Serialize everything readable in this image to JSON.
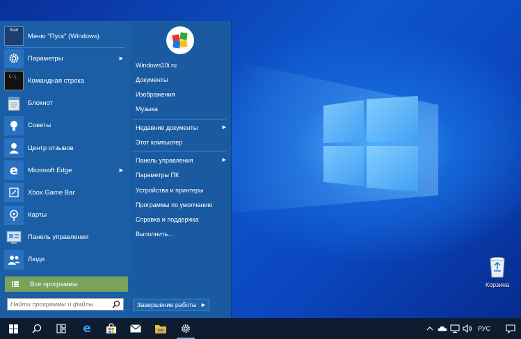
{
  "desktop": {
    "recycle_bin_label": "Корзина"
  },
  "start_menu": {
    "programs": [
      {
        "label": "Меню \"Пуск\" (Windows)",
        "icon": "start-menu-icon",
        "has_submenu": false
      },
      {
        "label": "Параметры",
        "icon": "gear-icon",
        "has_submenu": true
      },
      {
        "label": "Командная строка",
        "icon": "command-prompt-icon",
        "has_submenu": false
      },
      {
        "label": "Блокнот",
        "icon": "notepad-icon",
        "has_submenu": false
      },
      {
        "label": "Советы",
        "icon": "lightbulb-icon",
        "has_submenu": false
      },
      {
        "label": "Центр отзывов",
        "icon": "feedback-hub-icon",
        "has_submenu": false
      },
      {
        "label": "Microsoft Edge",
        "icon": "edge-icon",
        "has_submenu": true
      },
      {
        "label": "Xbox Game Bar",
        "icon": "xbox-game-bar-icon",
        "has_submenu": false
      },
      {
        "label": "Карты",
        "icon": "maps-icon",
        "has_submenu": false
      },
      {
        "label": "Панель управления",
        "icon": "control-panel-icon",
        "has_submenu": false
      },
      {
        "label": "Люди",
        "icon": "people-icon",
        "has_submenu": false
      }
    ],
    "start_badge_text": "Start",
    "all_programs_label": "Все программы",
    "search_placeholder": "Найти программы и файлы",
    "right_items": [
      {
        "label": "Windows10i.ru",
        "has_submenu": false
      },
      {
        "label": "Документы",
        "has_submenu": false
      },
      {
        "label": "Изображения",
        "has_submenu": false
      },
      {
        "label": "Музыка",
        "has_submenu": false
      },
      {
        "label": "Недавние документы",
        "has_submenu": true
      },
      {
        "label": "Этот компьютер",
        "has_submenu": false
      },
      {
        "label": "Панель управления",
        "has_submenu": true
      },
      {
        "label": "Параметры ПК",
        "has_submenu": false
      },
      {
        "label": "Устройства и принтеры",
        "has_submenu": false
      },
      {
        "label": "Программы по умолчанию",
        "has_submenu": false
      },
      {
        "label": "Справка и поддержка",
        "has_submenu": false
      },
      {
        "label": "Выполнить...",
        "has_submenu": false
      }
    ],
    "shutdown_label": "Завершение работы"
  },
  "taskbar": {
    "language": "РУС",
    "pinned": [
      "windows-start-icon",
      "search-icon",
      "task-view-icon",
      "edge-icon",
      "store-icon",
      "mail-icon",
      "file-explorer-icon",
      "settings-icon"
    ]
  },
  "colors": {
    "menu_bg": "#1b5ea6",
    "all_programs_bg": "#7aa35a",
    "taskbar_bg": "#0e1c30"
  }
}
